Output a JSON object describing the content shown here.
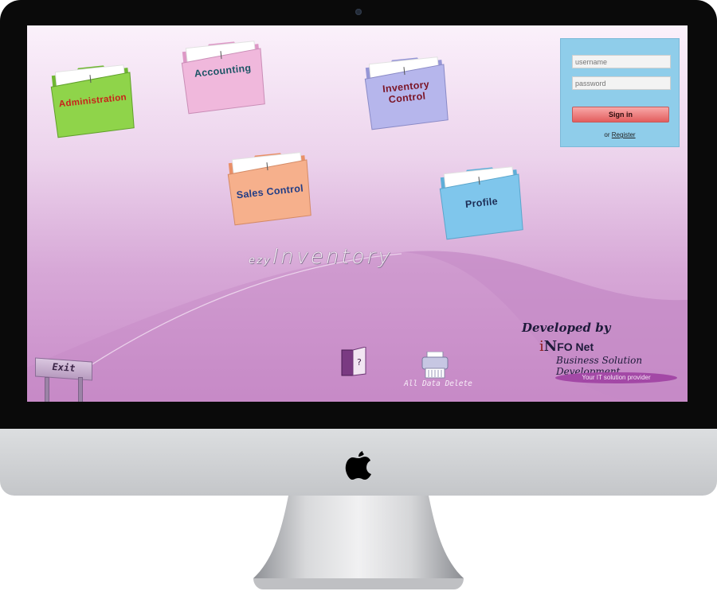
{
  "folders": [
    {
      "label": "Administration",
      "color": "#8fd44a"
    },
    {
      "label": "Accounting",
      "color": "#f0b8dc"
    },
    {
      "label": "Inventory Control",
      "line1": "Inventory",
      "line2": "Control",
      "color": "#b6b6ec"
    },
    {
      "label": "Sales Control",
      "color": "#f6b08c"
    },
    {
      "label": "Profile",
      "color": "#7fc6ec"
    }
  ],
  "login": {
    "username_placeholder": "username",
    "password_placeholder": "password",
    "signin_label": "Sign in",
    "or_text": "or",
    "register_label": "Register"
  },
  "logo": {
    "prefix": "ezy",
    "main": "Inventory"
  },
  "exit_label": "Exit",
  "delete_label": "All Data Delete",
  "credit": {
    "developed_by": "Developed by",
    "company_i": "i",
    "company_n": "N",
    "company_rest": "FO Net",
    "tagline": "Business Solution Development",
    "slogan": "Your IT solution provider"
  },
  "colors": {
    "screen_top": "#fbf1fb",
    "screen_bottom": "#c88ac8",
    "login_bg": "#8fcdea",
    "signin_button": "#e35e5e",
    "slogan_bg": "#a348a6"
  },
  "icons": [
    "folder-icon",
    "help-book-icon",
    "shredder-icon",
    "apple-logo-icon"
  ]
}
